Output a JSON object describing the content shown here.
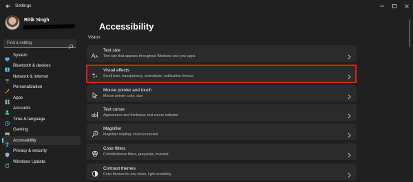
{
  "window": {
    "title": "Settings"
  },
  "user": {
    "name": "Ritik Singh"
  },
  "search": {
    "placeholder": "Find a setting"
  },
  "nav": [
    {
      "label": "System",
      "icon": "monitor-icon",
      "color": "#4cc2ff"
    },
    {
      "label": "Bluetooth & devices",
      "icon": "bluetooth-icon",
      "color": "#4cc2ff"
    },
    {
      "label": "Network & internet",
      "icon": "wifi-icon",
      "color": "#7fb3ff"
    },
    {
      "label": "Personalization",
      "icon": "brush-icon",
      "color": "#f0a35a"
    },
    {
      "label": "Apps",
      "icon": "apps-icon",
      "color": "#9fb8d8"
    },
    {
      "label": "Accounts",
      "icon": "person-icon",
      "color": "#4bd18a"
    },
    {
      "label": "Time & language",
      "icon": "clock-globe-icon",
      "color": "#4cc2ff"
    },
    {
      "label": "Gaming",
      "icon": "gamepad-icon",
      "color": "#b8b8b8"
    },
    {
      "label": "Accessibility",
      "icon": "accessibility-icon",
      "color": "#4cc2ff",
      "active": true
    },
    {
      "label": "Privacy & security",
      "icon": "shield-icon",
      "color": "#9fb0c0"
    },
    {
      "label": "Windows Update",
      "icon": "update-icon",
      "color": "#4cc2ff"
    }
  ],
  "page": {
    "title": "Accessibility",
    "section": "Vision"
  },
  "cards": [
    {
      "title": "Text size",
      "subtitle": "Text size that appears throughout Windows and your apps",
      "icon": "text-size-icon"
    },
    {
      "title": "Visual effects",
      "subtitle": "Scroll bars, transparency, animations, notification timeout",
      "icon": "sparkle-icon",
      "highlighted": true
    },
    {
      "title": "Mouse pointer and touch",
      "subtitle": "Mouse pointer color, size",
      "icon": "pointer-icon"
    },
    {
      "title": "Text cursor",
      "subtitle": "Appearance and thickness, text cursor indicator",
      "icon": "text-cursor-icon"
    },
    {
      "title": "Magnifier",
      "subtitle": "Magnifier reading, zoom increment",
      "icon": "magnifier-icon"
    },
    {
      "title": "Color filters",
      "subtitle": "Colorblindness filters, grayscale, inverted",
      "icon": "color-filter-icon"
    },
    {
      "title": "Contrast themes",
      "subtitle": "Color themes for low vision, light sensitivity",
      "icon": "contrast-icon"
    }
  ],
  "colors": {
    "accent": "#60cdff",
    "highlight": "#e0211c",
    "background": "#202020",
    "card": "#2b2b2b"
  }
}
